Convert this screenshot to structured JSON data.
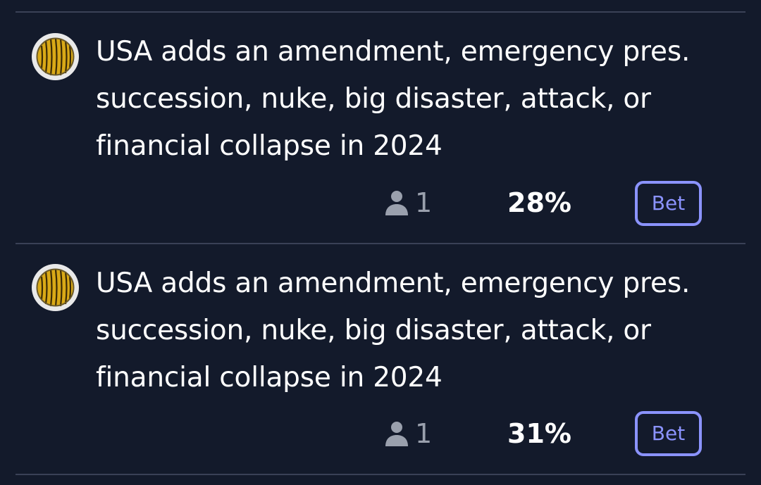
{
  "markets": [
    {
      "title_lines": [
        "USA adds an amendment, emergency pres.",
        "succession, nuke, big disaster, attack, or",
        "financial collapse in 2024"
      ],
      "traders": "1",
      "probability": "28%",
      "bet_label": "Bet",
      "avatar_icon": "yellow-pattern-avatar-icon"
    },
    {
      "title_lines": [
        "USA adds an amendment, emergency pres.",
        "succession, nuke, big disaster, attack, or",
        "financial collapse in 2024"
      ],
      "traders": "1",
      "probability": "31%",
      "bet_label": "Bet",
      "avatar_icon": "yellow-pattern-avatar-icon"
    }
  ],
  "colors": {
    "background": "#131a2b",
    "divider": "#3a4156",
    "accent": "#8b93ff",
    "muted_text": "#9aa0ad",
    "avatar_yellow": "#e2b51c"
  }
}
